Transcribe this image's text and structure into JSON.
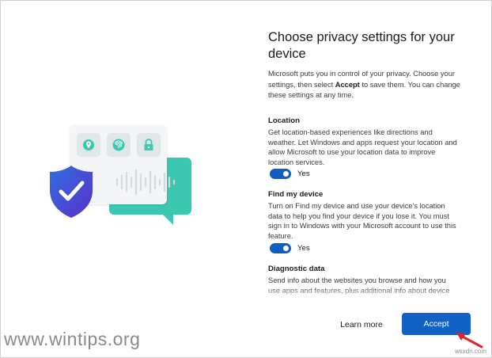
{
  "page": {
    "title": "Choose privacy settings for your device",
    "intro_before": "Microsoft puts you in control of your privacy. Choose your settings, then select ",
    "intro_bold": "Accept",
    "intro_after": " to save them. You can change these settings at any time."
  },
  "sections": [
    {
      "title": "Location",
      "description": "Get location-based experiences like directions and weather. Let Windows and apps request your location and allow Microsoft to use your location data to improve location services.",
      "toggle_label": "Yes",
      "toggle_on": true
    },
    {
      "title": "Find my device",
      "description": "Turn on Find my device and use your device's location data to help you find your device if you lose it. You must sign in to Windows with your Microsoft account to use this feature.",
      "toggle_label": "Yes",
      "toggle_on": true
    },
    {
      "title": "Diagnostic data",
      "description": "Send info about the websites you browse and how you use apps and features, plus additional info about device health, device activity, and enhanced error reporting."
    }
  ],
  "buttons": {
    "learn_more": "Learn more",
    "accept": "Accept"
  },
  "illustration": {
    "icons": [
      "location-pin-icon",
      "fingerprint-icon",
      "lock-icon",
      "shield-check-icon"
    ]
  },
  "watermark": {
    "text": "www.wintips.org",
    "credit": "wsxdn.com"
  },
  "colors": {
    "accent": "#1261c4",
    "toggle": "#0f5fc0",
    "teal": "#3bc7b1",
    "shield": "#4a3fd4",
    "arrow": "#e0252a"
  }
}
